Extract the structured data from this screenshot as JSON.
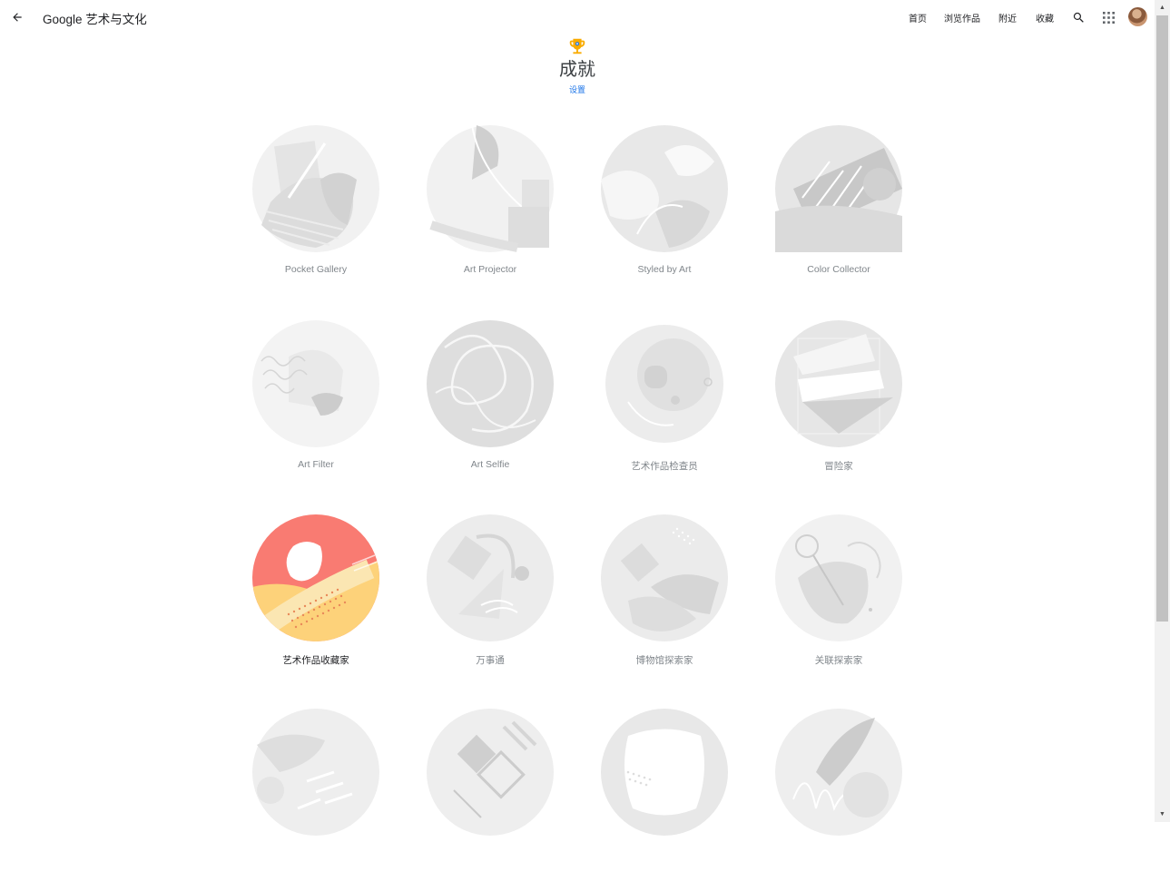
{
  "topbar": {
    "brand": "Google 艺术与文化",
    "nav": {
      "home": "首页",
      "browse": "浏览作品",
      "nearby": "附近",
      "favorites": "收藏"
    },
    "icons": {
      "back": "arrow-left-icon",
      "search": "search-icon",
      "apps": "apps-grid-icon",
      "avatar": "user-avatar"
    }
  },
  "header": {
    "icon": "trophy-icon",
    "title": "成就",
    "settings_label": "设置"
  },
  "achievements": [
    {
      "label": "Pocket Gallery",
      "earned": false
    },
    {
      "label": "Art Projector",
      "earned": false
    },
    {
      "label": "Styled by Art",
      "earned": false
    },
    {
      "label": "Color Collector",
      "earned": false
    },
    {
      "label": "Art Filter",
      "earned": false
    },
    {
      "label": "Art Selfie",
      "earned": false
    },
    {
      "label": "艺术作品检查员",
      "earned": false
    },
    {
      "label": "冒险家",
      "earned": false
    },
    {
      "label": "艺术作品收藏家",
      "earned": true
    },
    {
      "label": "万事通",
      "earned": false
    },
    {
      "label": "博物馆探索家",
      "earned": false
    },
    {
      "label": "关联探索家",
      "earned": false
    },
    {
      "label": "",
      "earned": false
    },
    {
      "label": "",
      "earned": false
    },
    {
      "label": "",
      "earned": false
    },
    {
      "label": "",
      "earned": false
    }
  ],
  "colors": {
    "accent_link": "#1a73e8",
    "trophy": "#f9ab00",
    "earned_top": "#f97b72",
    "earned_bottom": "#fdd27a",
    "locked_badge": "#eeeeee"
  }
}
